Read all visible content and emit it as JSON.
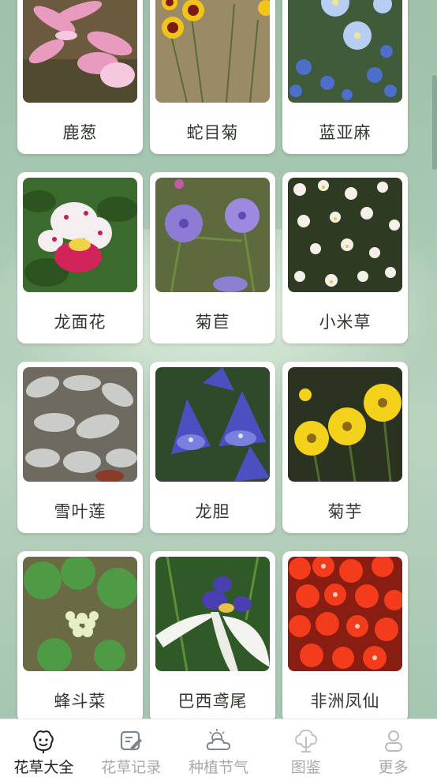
{
  "plants": [
    {
      "name": "鹿葱",
      "image": "pink-lily-photo"
    },
    {
      "name": "蛇目菊",
      "image": "coreopsis-photo"
    },
    {
      "name": "蓝亚麻",
      "image": "blue-flax-photo"
    },
    {
      "name": "龙面花",
      "image": "nemesia-photo"
    },
    {
      "name": "菊苣",
      "image": "chicory-photo"
    },
    {
      "name": "小米草",
      "image": "eyebright-photo"
    },
    {
      "name": "雪叶莲",
      "image": "dusty-miller-photo"
    },
    {
      "name": "龙胆",
      "image": "gentian-photo"
    },
    {
      "name": "菊芋",
      "image": "jerusalem-artichoke-photo"
    },
    {
      "name": "蜂斗菜",
      "image": "butterbur-photo"
    },
    {
      "name": "巴西鸢尾",
      "image": "walking-iris-photo"
    },
    {
      "name": "非洲凤仙",
      "image": "impatiens-photo"
    }
  ],
  "tabbar": {
    "tabs": [
      {
        "label": "花草大全",
        "icon": "flower-face-icon",
        "active": true
      },
      {
        "label": "花草记录",
        "icon": "note-edit-icon",
        "active": false
      },
      {
        "label": "种植节气",
        "icon": "weather-cloud-icon",
        "active": false
      },
      {
        "label": "图鉴",
        "icon": "plant-catalog-icon",
        "active": false
      },
      {
        "label": "更多",
        "icon": "user-icon",
        "active": false
      }
    ]
  },
  "colors": {
    "background": "#a9c9b4",
    "card": "#ffffff",
    "text": "#2e3b2c",
    "tab_active": "#1f1f1f",
    "tab_inactive": "#a9a9a9"
  }
}
